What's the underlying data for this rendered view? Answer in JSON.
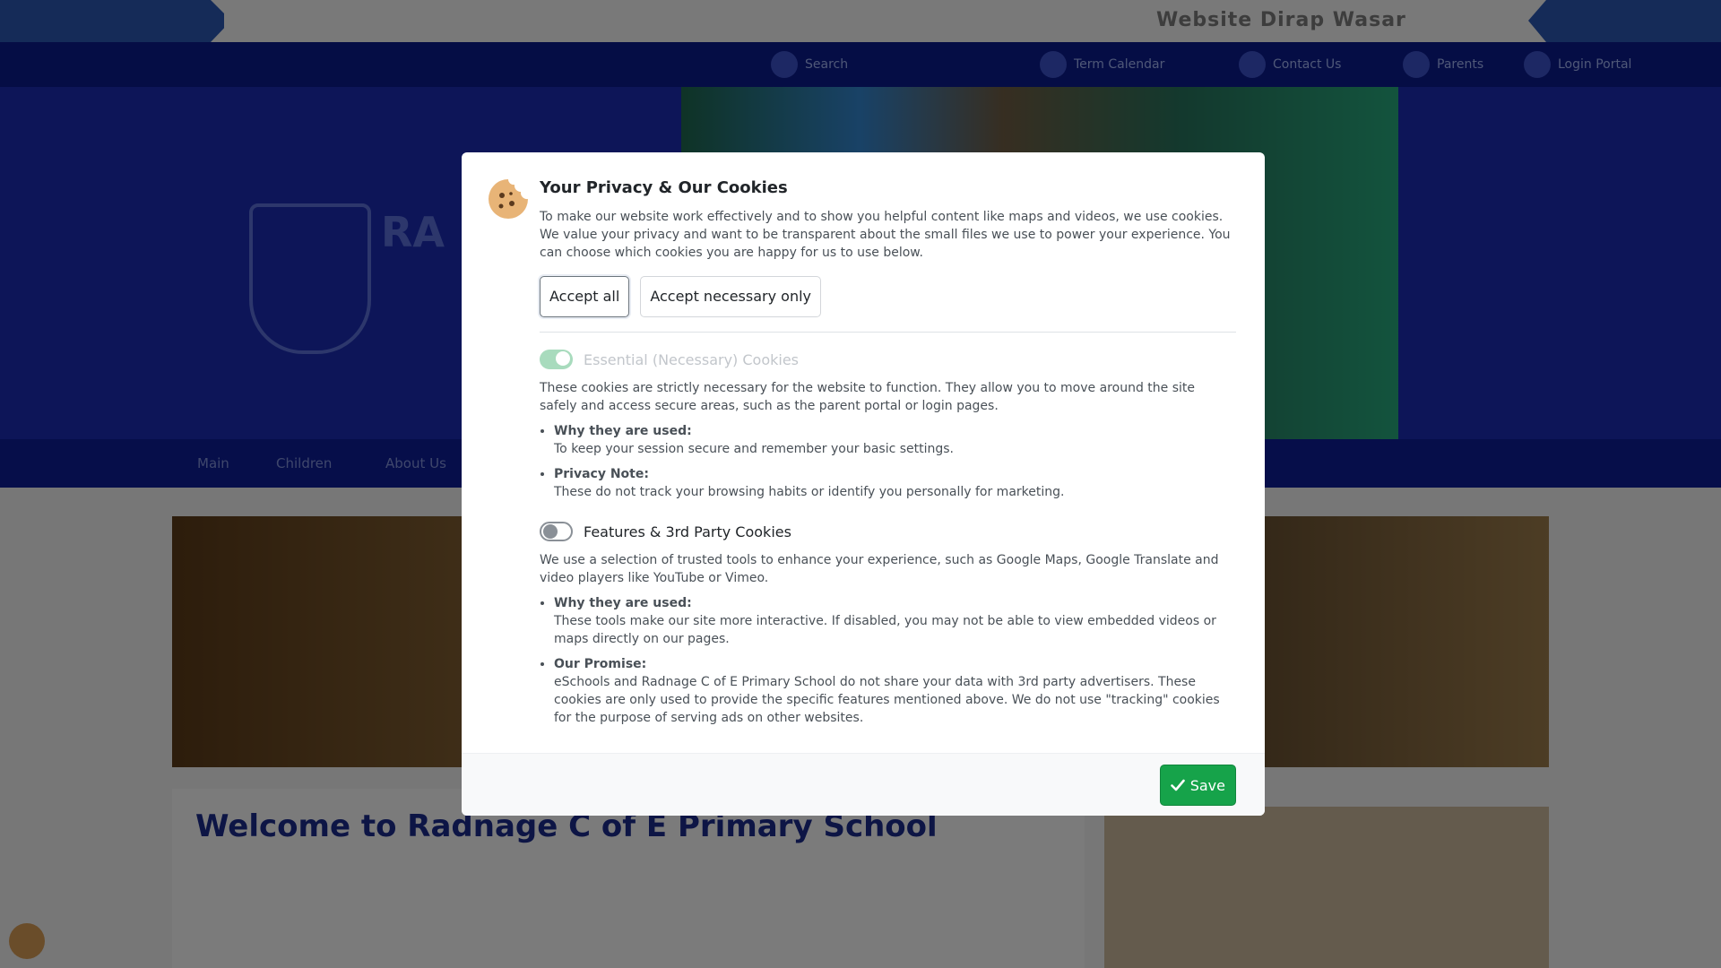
{
  "background": {
    "topbar_title": "Website Dirap Wasar",
    "welcome_heading": "Welcome to Radnage C of E Primary School",
    "hero_name": "RA",
    "utility_items": [
      "Search",
      "Term Calendar",
      "Contact Us",
      "Parents",
      "Login Portal"
    ],
    "nav_items": [
      "Main",
      "Children",
      "About Us"
    ]
  },
  "modal": {
    "title": "Your Privacy & Our Cookies",
    "intro": "To make our website work effectively and to show you helpful content like maps and videos, we use cookies. We value your privacy and want to be transparent about the small files we use to power your experience. You can choose which cookies you are happy for us to use below.",
    "accept_all_label": "Accept all",
    "accept_necessary_label": "Accept necessary only",
    "sections": [
      {
        "title": "Essential (Necessary) Cookies",
        "enabled": true,
        "locked": true,
        "description": "These cookies are strictly necessary for the website to function. They allow you to move around the site safely and access secure areas, such as the parent portal or login pages.",
        "points": [
          {
            "title": "Why they are used:",
            "text": "To keep your session secure and remember your basic settings."
          },
          {
            "title": "Privacy Note:",
            "text": "These do not track your browsing habits or identify you personally for marketing."
          }
        ]
      },
      {
        "title": "Features & 3rd Party Cookies",
        "enabled": false,
        "locked": false,
        "description": "We use a selection of trusted tools to enhance your experience, such as Google Maps, Google Translate and video players like YouTube or Vimeo.",
        "points": [
          {
            "title": "Why they are used:",
            "text": "These tools make our site more interactive. If disabled, you may not be able to view embedded videos or maps directly on our pages."
          },
          {
            "title": "Our Promise:",
            "text": "eSchools and Radnage C of E Primary School do not share your data with 3rd party advertisers. These cookies are only used to provide the specific features mentioned above. We do not use \"tracking\" cookies for the purpose of serving ads on other websites."
          }
        ]
      }
    ],
    "save_label": "Save",
    "icons": {
      "modal": "cookie-icon",
      "save": "check-icon"
    }
  },
  "colors": {
    "save_green": "#16a34a",
    "toggle_on": "#a8dbbd",
    "overlay": "rgba(0,0,0,0.5)"
  }
}
